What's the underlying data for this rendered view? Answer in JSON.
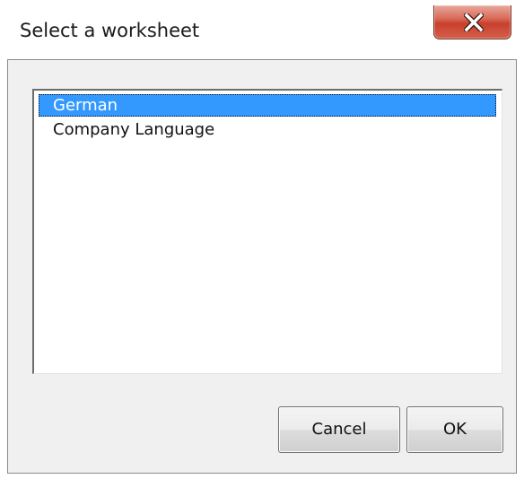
{
  "window": {
    "title": "Select a worksheet",
    "close_icon": "close-icon"
  },
  "listbox": {
    "items": [
      {
        "label": "German",
        "selected": true
      },
      {
        "label": "Company Language",
        "selected": false
      }
    ]
  },
  "buttons": {
    "cancel_label": "Cancel",
    "ok_label": "OK"
  },
  "colors": {
    "selection": "#3399ff",
    "close_button": "#c8402c",
    "client_background": "#f0f0f0"
  }
}
